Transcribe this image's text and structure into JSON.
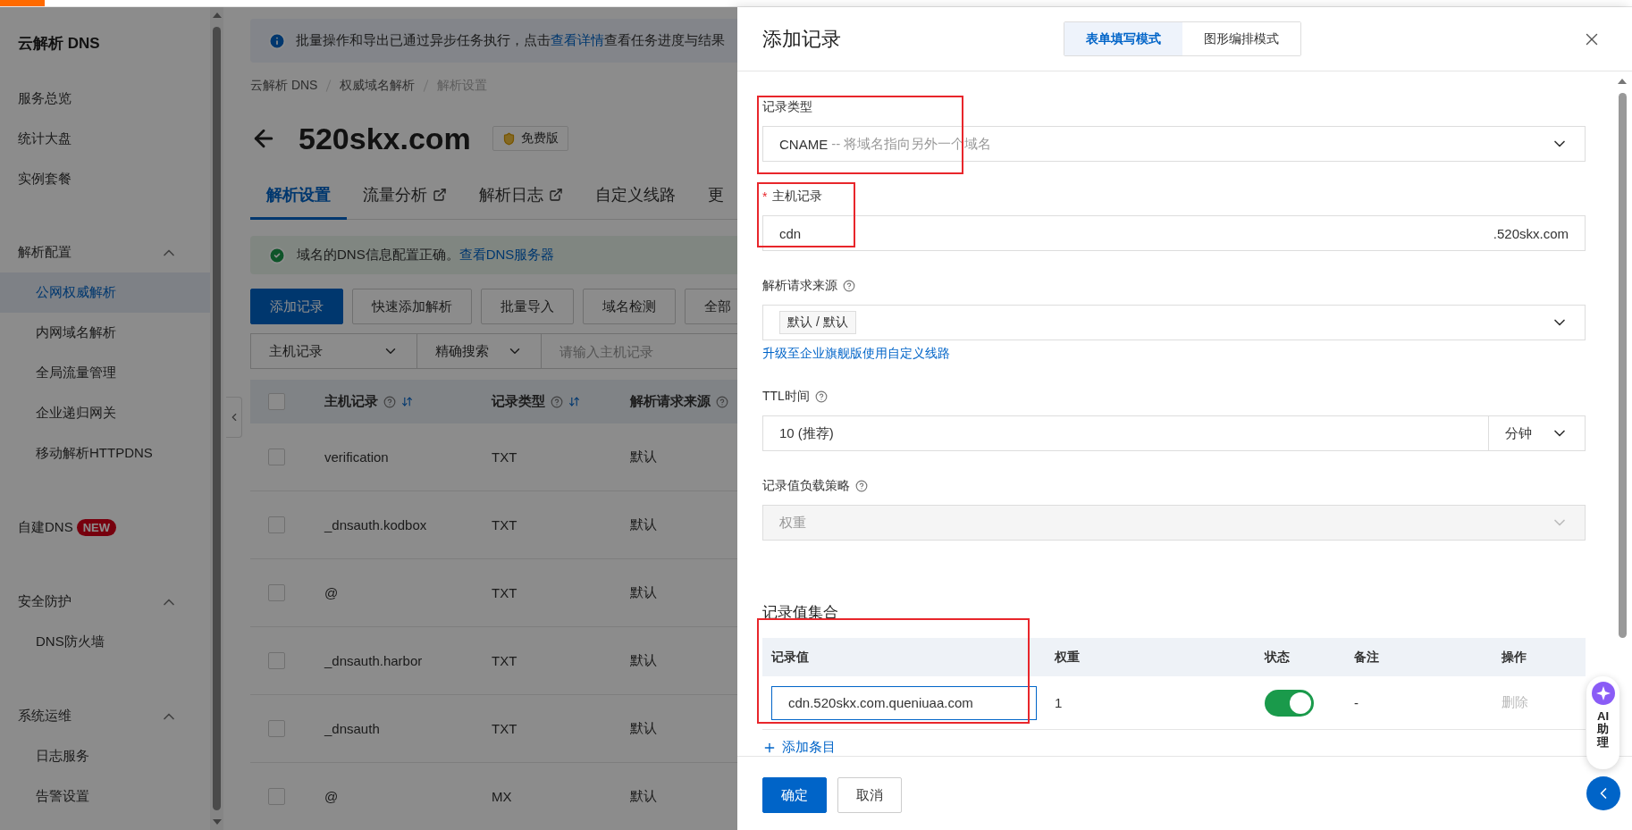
{
  "sidebar": {
    "title": "云解析 DNS",
    "sections": [
      {
        "items": [
          {
            "label": "服务总览",
            "selected": false
          },
          {
            "label": "统计大盘",
            "selected": false
          },
          {
            "label": "实例套餐",
            "selected": false
          }
        ]
      },
      {
        "heading": "解析配置",
        "expanded": true,
        "items": [
          {
            "label": "公网权威解析",
            "selected": true
          },
          {
            "label": "内网域名解析",
            "selected": false
          },
          {
            "label": "全局流量管理",
            "selected": false
          },
          {
            "label": "企业递归网关",
            "selected": false
          },
          {
            "label": "移动解析HTTPDNS",
            "selected": false
          }
        ]
      },
      {
        "items": [
          {
            "label": "自建DNS",
            "badge": "NEW",
            "selected": false
          }
        ]
      },
      {
        "heading": "安全防护",
        "expanded": true,
        "items": [
          {
            "label": "DNS防火墙",
            "selected": false
          }
        ]
      },
      {
        "heading": "系统运维",
        "expanded": true,
        "items": [
          {
            "label": "日志服务",
            "selected": false
          },
          {
            "label": "告警设置",
            "selected": false
          }
        ]
      }
    ]
  },
  "main": {
    "notice": {
      "text_before": "批量操作和导出已通过异步任务执行，点击",
      "link": "查看详情",
      "text_after": "查看任务进度与结果"
    },
    "breadcrumb": [
      "云解析 DNS",
      "权威域名解析",
      "解析设置"
    ],
    "domain": "520skx.com",
    "plan": "免费版",
    "tabs": [
      {
        "label": "解析设置",
        "external": false,
        "selected": true
      },
      {
        "label": "流量分析",
        "external": true,
        "selected": false
      },
      {
        "label": "解析日志",
        "external": true,
        "selected": false
      },
      {
        "label": "自定义线路",
        "external": false,
        "selected": false
      },
      {
        "label": "更",
        "external": false,
        "selected": false
      }
    ],
    "status": {
      "text": "域名的DNS信息配置正确。",
      "link": "查看DNS服务器"
    },
    "actions": [
      {
        "label": "添加记录",
        "primary": true
      },
      {
        "label": "快速添加解析",
        "primary": false
      },
      {
        "label": "批量导入",
        "primary": false
      },
      {
        "label": "域名检测",
        "primary": false
      },
      {
        "label": "全部",
        "primary": false
      }
    ],
    "filter": {
      "field": "主机记录",
      "mode": "精确搜索",
      "placeholder": "请输入主机记录"
    },
    "table": {
      "all_checked": false,
      "columns": [
        {
          "label": "主机记录",
          "help": true,
          "sortable": true
        },
        {
          "label": "记录类型",
          "help": true,
          "sortable": true
        },
        {
          "label": "解析请求来源",
          "help": true,
          "sortable": false
        }
      ],
      "rows": [
        {
          "host": "verification",
          "type": "TXT",
          "source": "默认",
          "checked": false
        },
        {
          "host": "_dnsauth.kodbox",
          "type": "TXT",
          "source": "默认",
          "checked": false
        },
        {
          "host": "@",
          "type": "TXT",
          "source": "默认",
          "checked": false
        },
        {
          "host": "_dnsauth.harbor",
          "type": "TXT",
          "source": "默认",
          "checked": false
        },
        {
          "host": "_dnsauth",
          "type": "TXT",
          "source": "默认",
          "checked": false
        },
        {
          "host": "@",
          "type": "MX",
          "source": "默认",
          "checked": false
        }
      ]
    }
  },
  "drawer": {
    "title": "添加记录",
    "modes": [
      {
        "label": "表单填写模式",
        "selected": true
      },
      {
        "label": "图形编排模式",
        "selected": false
      }
    ],
    "record_type": {
      "label": "记录类型",
      "value": "CNAME",
      "hint": "-- 将域名指向另外一个域名",
      "highlighted": true
    },
    "host": {
      "label": "主机记录",
      "required_mark": "*",
      "value": "cdn",
      "suffix": ".520skx.com",
      "highlighted": true
    },
    "source": {
      "label": "解析请求来源",
      "help": true,
      "value": "默认 / 默认",
      "link": "升级至企业旗舰版使用自定义线路"
    },
    "ttl": {
      "label": "TTL时间",
      "help": true,
      "value": "10 (推荐)",
      "unit": "分钟"
    },
    "strategy": {
      "label": "记录值负载策略",
      "help": true,
      "value": "权重",
      "disabled": true
    },
    "values": {
      "title": "记录值集合",
      "highlighted": true,
      "columns": [
        "记录值",
        "权重",
        "状态",
        "备注",
        "操作"
      ],
      "rows": [
        {
          "value": "cdn.520skx.com.queniuaa.com",
          "weight": "1",
          "enabled": true,
          "remark": "-",
          "action": "删除",
          "action_disabled": true
        }
      ],
      "add": "添加条目"
    },
    "buttons": [
      {
        "label": "确定",
        "primary": true
      },
      {
        "label": "取消",
        "primary": false
      }
    ]
  },
  "assistant": {
    "label": "AI助理"
  }
}
